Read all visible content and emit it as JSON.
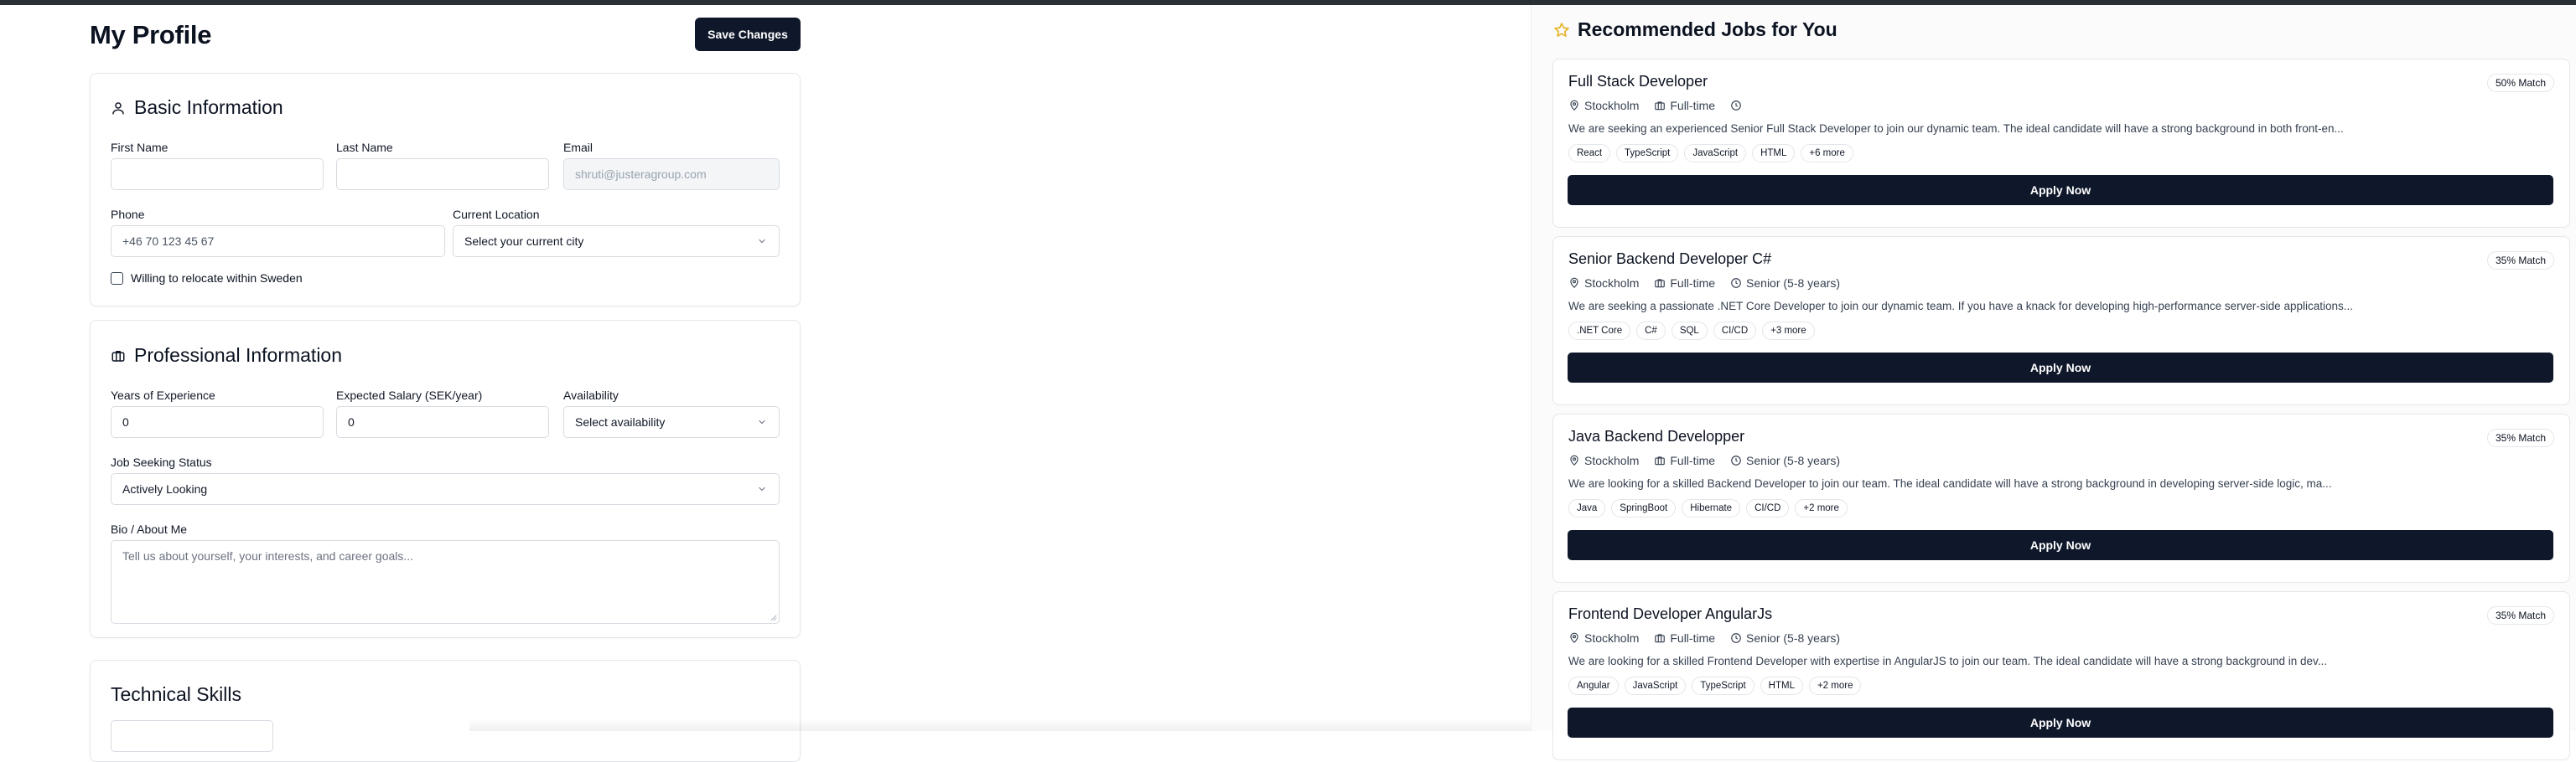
{
  "profile": {
    "title": "My Profile",
    "save_label": "Save Changes",
    "basic": {
      "title": "Basic Information",
      "first_name_label": "First Name",
      "last_name_label": "Last Name",
      "email_label": "Email",
      "email_value": "shruti@justeragroup.com",
      "phone_label": "Phone",
      "phone_placeholder": "+46 70 123 45 67",
      "location_label": "Current Location",
      "location_value": "Select your current city",
      "relocate_label": "Willing to relocate within Sweden",
      "relocate_checked": false
    },
    "professional": {
      "title": "Professional Information",
      "experience_label": "Years of Experience",
      "experience_value": "0",
      "salary_label": "Expected Salary (SEK/year)",
      "salary_value": "0",
      "availability_label": "Availability",
      "availability_value": "Select availability",
      "status_label": "Job Seeking Status",
      "status_value": "Actively Looking",
      "bio_label": "Bio / About Me",
      "bio_placeholder": "Tell us about yourself, your interests, and career goals..."
    },
    "technical": {
      "title": "Technical Skills"
    }
  },
  "jobs": {
    "title": "Recommended Jobs for You",
    "apply_label": "Apply Now",
    "items": [
      {
        "title": "Full Stack Developer",
        "match": "50% Match",
        "location": "Stockholm",
        "type": "Full-time",
        "level": "",
        "description": "We are seeking an experienced Senior Full Stack Developer to join our dynamic team. The ideal candidate will have a strong background in both front-en...",
        "tags": [
          "React",
          "TypeScript",
          "JavaScript",
          "HTML",
          "+6 more"
        ]
      },
      {
        "title": "Senior Backend Developer C#",
        "match": "35% Match",
        "location": "Stockholm",
        "type": "Full-time",
        "level": "Senior (5-8 years)",
        "description": "We are seeking a passionate .NET Core Developer to join our dynamic team. If you have a knack for developing high-performance server-side applications...",
        "tags": [
          ".NET Core",
          "C#",
          "SQL",
          "CI/CD",
          "+3 more"
        ]
      },
      {
        "title": "Java Backend Developper",
        "match": "35% Match",
        "location": "Stockholm",
        "type": "Full-time",
        "level": "Senior (5-8 years)",
        "description": "We are looking for a skilled Backend Developer to join our team. The ideal candidate will have a strong background in developing server-side logic, ma...",
        "tags": [
          "Java",
          "SpringBoot",
          "Hibernate",
          "CI/CD",
          "+2 more"
        ]
      },
      {
        "title": "Frontend Developer AngularJs",
        "match": "35% Match",
        "location": "Stockholm",
        "type": "Full-time",
        "level": "Senior (5-8 years)",
        "description": "We are looking for a skilled Frontend Developer with expertise in AngularJS to join our team. The ideal candidate will have a strong background in dev...",
        "tags": [
          "Angular",
          "JavaScript",
          "TypeScript",
          "HTML",
          "+2 more"
        ]
      }
    ]
  },
  "colors": {
    "primary": "#0f172a",
    "star": "#e6b325",
    "border": "#e3e6ea"
  }
}
